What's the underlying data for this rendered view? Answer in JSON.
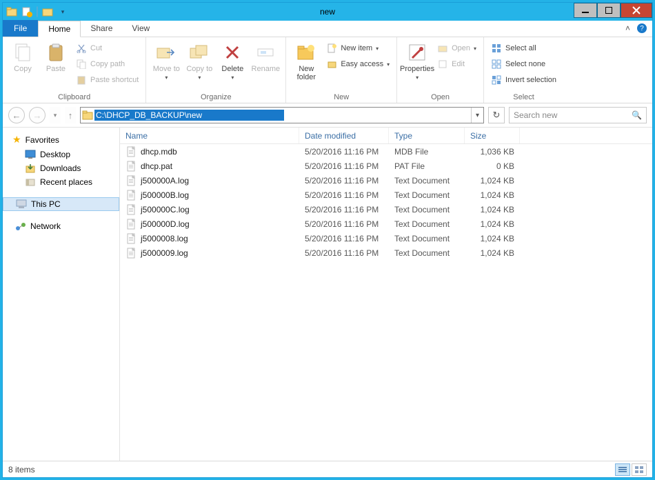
{
  "window": {
    "title": "new"
  },
  "tabs": {
    "file": "File",
    "home": "Home",
    "share": "Share",
    "view": "View"
  },
  "ribbon": {
    "clipboard": {
      "label": "Clipboard",
      "copy": "Copy",
      "paste": "Paste",
      "cut": "Cut",
      "copy_path": "Copy path",
      "paste_shortcut": "Paste shortcut"
    },
    "organize": {
      "label": "Organize",
      "move_to": "Move\nto",
      "copy_to": "Copy\nto",
      "delete": "Delete",
      "rename": "Rename"
    },
    "new": {
      "label": "New",
      "new_folder": "New\nfolder",
      "new_item": "New item",
      "easy_access": "Easy access"
    },
    "open": {
      "label": "Open",
      "properties": "Properties",
      "open": "Open",
      "edit": "Edit"
    },
    "select": {
      "label": "Select",
      "select_all": "Select all",
      "select_none": "Select none",
      "invert": "Invert selection"
    }
  },
  "address": {
    "path": "C:\\DHCP_DB_BACKUP\\new"
  },
  "search": {
    "placeholder": "Search new"
  },
  "sidebar": {
    "favorites": "Favorites",
    "desktop": "Desktop",
    "downloads": "Downloads",
    "recent": "Recent places",
    "this_pc": "This PC",
    "network": "Network"
  },
  "columns": {
    "name": "Name",
    "date": "Date modified",
    "type": "Type",
    "size": "Size"
  },
  "files": [
    {
      "name": "dhcp.mdb",
      "date": "5/20/2016 11:16 PM",
      "type": "MDB File",
      "size": "1,036 KB"
    },
    {
      "name": "dhcp.pat",
      "date": "5/20/2016 11:16 PM",
      "type": "PAT File",
      "size": "0 KB"
    },
    {
      "name": "j500000A.log",
      "date": "5/20/2016 11:16 PM",
      "type": "Text Document",
      "size": "1,024 KB"
    },
    {
      "name": "j500000B.log",
      "date": "5/20/2016 11:16 PM",
      "type": "Text Document",
      "size": "1,024 KB"
    },
    {
      "name": "j500000C.log",
      "date": "5/20/2016 11:16 PM",
      "type": "Text Document",
      "size": "1,024 KB"
    },
    {
      "name": "j500000D.log",
      "date": "5/20/2016 11:16 PM",
      "type": "Text Document",
      "size": "1,024 KB"
    },
    {
      "name": "j5000008.log",
      "date": "5/20/2016 11:16 PM",
      "type": "Text Document",
      "size": "1,024 KB"
    },
    {
      "name": "j5000009.log",
      "date": "5/20/2016 11:16 PM",
      "type": "Text Document",
      "size": "1,024 KB"
    }
  ],
  "status": {
    "count": "8 items"
  }
}
